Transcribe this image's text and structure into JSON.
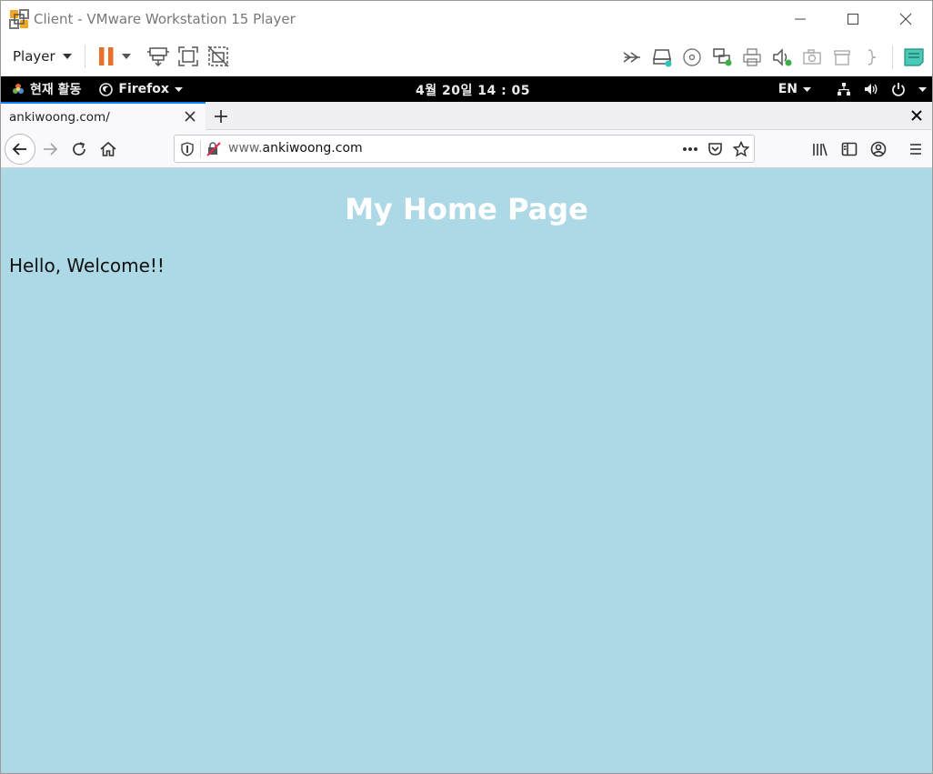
{
  "window": {
    "title": "Client - VMware Workstation 15 Player"
  },
  "vm_toolbar": {
    "player_menu_label": "Player"
  },
  "gnome_bar": {
    "activities_label": "현재 활동",
    "app_menu_label": "Firefox",
    "clock": "4월 20일  14 : 05",
    "input_language": "EN"
  },
  "browser": {
    "tab_title": "ankiwoong.com/",
    "url_prefix": "www.",
    "url_domain": "ankiwoong.com"
  },
  "page": {
    "heading": "My Home Page",
    "paragraph": "Hello, Welcome!!",
    "background_color": "#add8e6"
  },
  "colors": {
    "pause_orange": "#e8702a",
    "tab_accent": "#0a84ff"
  }
}
